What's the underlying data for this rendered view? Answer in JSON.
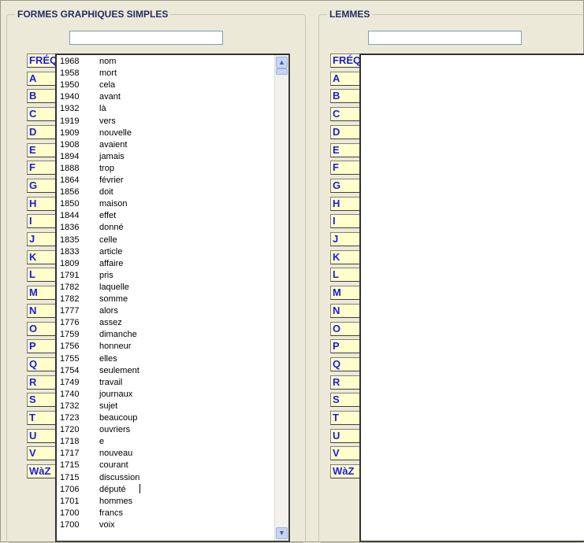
{
  "left_panel": {
    "title": "FORMES GRAPHIQUES SIMPLES",
    "search_value": "",
    "letters": [
      "FRÉQ",
      "A",
      "B",
      "C",
      "D",
      "E",
      "F",
      "G",
      "H",
      "I",
      "J",
      "K",
      "L",
      "M",
      "N",
      "O",
      "P",
      "Q",
      "R",
      "S",
      "T",
      "U",
      "V",
      "WàZ"
    ],
    "list": [
      {
        "freq": "1968",
        "word": "nom"
      },
      {
        "freq": "1958",
        "word": "mort"
      },
      {
        "freq": "1950",
        "word": "cela"
      },
      {
        "freq": "1940",
        "word": "avant"
      },
      {
        "freq": "1932",
        "word": "là"
      },
      {
        "freq": "1919",
        "word": "vers"
      },
      {
        "freq": "1909",
        "word": "nouvelle"
      },
      {
        "freq": "1908",
        "word": "avaient"
      },
      {
        "freq": "1894",
        "word": "jamais"
      },
      {
        "freq": "1888",
        "word": "trop"
      },
      {
        "freq": "1864",
        "word": "février"
      },
      {
        "freq": "1856",
        "word": "doit"
      },
      {
        "freq": "1850",
        "word": "maison"
      },
      {
        "freq": "1844",
        "word": "effet"
      },
      {
        "freq": "1836",
        "word": "donné"
      },
      {
        "freq": "1835",
        "word": "celle"
      },
      {
        "freq": "1833",
        "word": "article"
      },
      {
        "freq": "1809",
        "word": "affaire"
      },
      {
        "freq": "1791",
        "word": "pris"
      },
      {
        "freq": "1782",
        "word": "laquelle"
      },
      {
        "freq": "1782",
        "word": "somme"
      },
      {
        "freq": "1777",
        "word": "alors"
      },
      {
        "freq": "1776",
        "word": "assez"
      },
      {
        "freq": "1759",
        "word": "dimanche"
      },
      {
        "freq": "1756",
        "word": "honneur"
      },
      {
        "freq": "1755",
        "word": "elles"
      },
      {
        "freq": "1754",
        "word": "seulement"
      },
      {
        "freq": "1749",
        "word": "travail"
      },
      {
        "freq": "1740",
        "word": "journaux"
      },
      {
        "freq": "1732",
        "word": "sujet"
      },
      {
        "freq": "1723",
        "word": "beaucoup"
      },
      {
        "freq": "1720",
        "word": "ouvriers"
      },
      {
        "freq": "1718",
        "word": "e"
      },
      {
        "freq": "1717",
        "word": "nouveau"
      },
      {
        "freq": "1715",
        "word": "courant"
      },
      {
        "freq": "1715",
        "word": "discussion"
      },
      {
        "freq": "1706",
        "word": "député"
      },
      {
        "freq": "1701",
        "word": "hommes"
      },
      {
        "freq": "1700",
        "word": "francs"
      },
      {
        "freq": "1700",
        "word": "voix"
      }
    ],
    "scroll_up_glyph": "▲",
    "scroll_down_glyph": "▼"
  },
  "right_panel": {
    "title": "LEMMES",
    "search_value": "",
    "letters": [
      "FRÉQ",
      "A",
      "B",
      "C",
      "D",
      "E",
      "F",
      "G",
      "H",
      "I",
      "J",
      "K",
      "L",
      "M",
      "N",
      "O",
      "P",
      "Q",
      "R",
      "S",
      "T",
      "U",
      "V",
      "WàZ"
    ]
  },
  "colors": {
    "window_bg": "#ece9d8",
    "letter_button_bg": "#ffffcc",
    "letter_button_text": "#1a1ae6",
    "title_text": "#1f2f66",
    "scrollbar_button": "#c6d5f5"
  }
}
